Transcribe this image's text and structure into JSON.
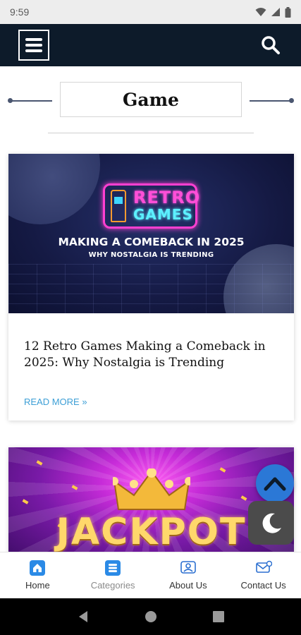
{
  "status_bar": {
    "time": "9:59",
    "icons": [
      "wifi-icon",
      "signal-icon",
      "battery-icon"
    ]
  },
  "header": {
    "menu_icon": "hamburger-menu-icon",
    "search_icon": "search-icon",
    "background": "#0d1b2a"
  },
  "category": {
    "title": "Game"
  },
  "posts": [
    {
      "image": {
        "logo_line1": "RETRO",
        "logo_line2": "GAMES",
        "headline": "MAKING A COMEBACK IN 2025",
        "subheadline": "WHY NOSTALGIA IS TRENDING"
      },
      "title": "12 Retro Games Making a Comeback in 2025: Why Nostalgia is Trending",
      "read_more": "READ MORE »"
    },
    {
      "image": {
        "text": "JACKPOT"
      }
    }
  ],
  "floating": {
    "scroll_top_icon": "chevron-up-icon",
    "dark_mode_icon": "moon-icon"
  },
  "bottom_nav": {
    "items": [
      {
        "label": "Home",
        "icon": "home-icon"
      },
      {
        "label": "Categories",
        "icon": "categories-icon"
      },
      {
        "label": "About Us",
        "icon": "about-icon"
      },
      {
        "label": "Contact Us",
        "icon": "contact-icon"
      }
    ]
  },
  "system_nav": {
    "icons": [
      "back-icon",
      "home-circle-icon",
      "recents-icon"
    ]
  },
  "colors": {
    "accent_blue": "#3d9fd6",
    "fab_blue": "#2b78d6",
    "nav_dark": "#0d1b2a"
  }
}
